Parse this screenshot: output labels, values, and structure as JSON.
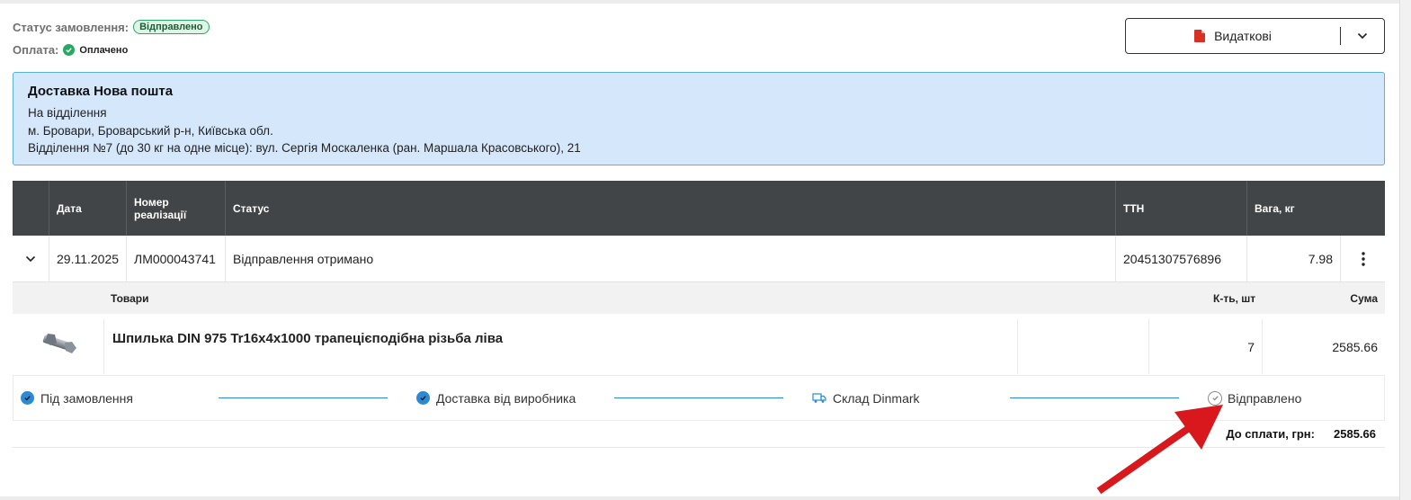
{
  "order": {
    "status_label": "Статус замовлення:",
    "status_value": "Відправлено",
    "payment_label": "Оплата:",
    "payment_value": "Оплачено"
  },
  "doc_button": {
    "label": "Видаткові",
    "icon": "pdf-icon",
    "dropdown_icon": "chevron-down-icon"
  },
  "delivery": {
    "title": "Доставка Нова пошта",
    "lines": [
      "На відділення",
      "м. Бровари, Броварський р-н, Київська обл.",
      "Відділення №7 (до 30 кг на одне місце): вул. Сергія Москаленка (ран. Маршала Красовського), 21"
    ]
  },
  "shipments": {
    "columns": [
      "Дата",
      "Номер реалізації",
      "Статус",
      "ТТН",
      "Вага, кг"
    ],
    "rows": [
      {
        "date": "29.11.2025",
        "number": "ЛМ000043741",
        "status": "Відправлення отримано",
        "ttn": "20451307576896",
        "weight": "7.98"
      }
    ]
  },
  "goods": {
    "columns": {
      "name": "Товари",
      "qty": "К-ть, шт",
      "sum": "Сума"
    },
    "items": [
      {
        "name": "Шпилька DIN 975 Tr16x4x1000 трапецієподібна різьба ліва",
        "qty": "7",
        "sum": "2585.66"
      }
    ]
  },
  "progress": {
    "steps": [
      {
        "label": "Під замовлення",
        "icon": "check-circle-icon"
      },
      {
        "label": "Доставка від виробника",
        "icon": "check-circle-icon"
      },
      {
        "label": "Склад Dinmark",
        "icon": "truck-icon"
      },
      {
        "label": "Відправлено",
        "icon": "check-outline-icon"
      }
    ]
  },
  "total": {
    "label": "До сплати, грн:",
    "value": "2585.66"
  },
  "colors": {
    "accent": "#2a8ad6",
    "header_bg": "#424548",
    "delivery_bg": "#d5e7fb",
    "badge_green": "#27a864",
    "annotation_arrow": "#d8181c"
  }
}
